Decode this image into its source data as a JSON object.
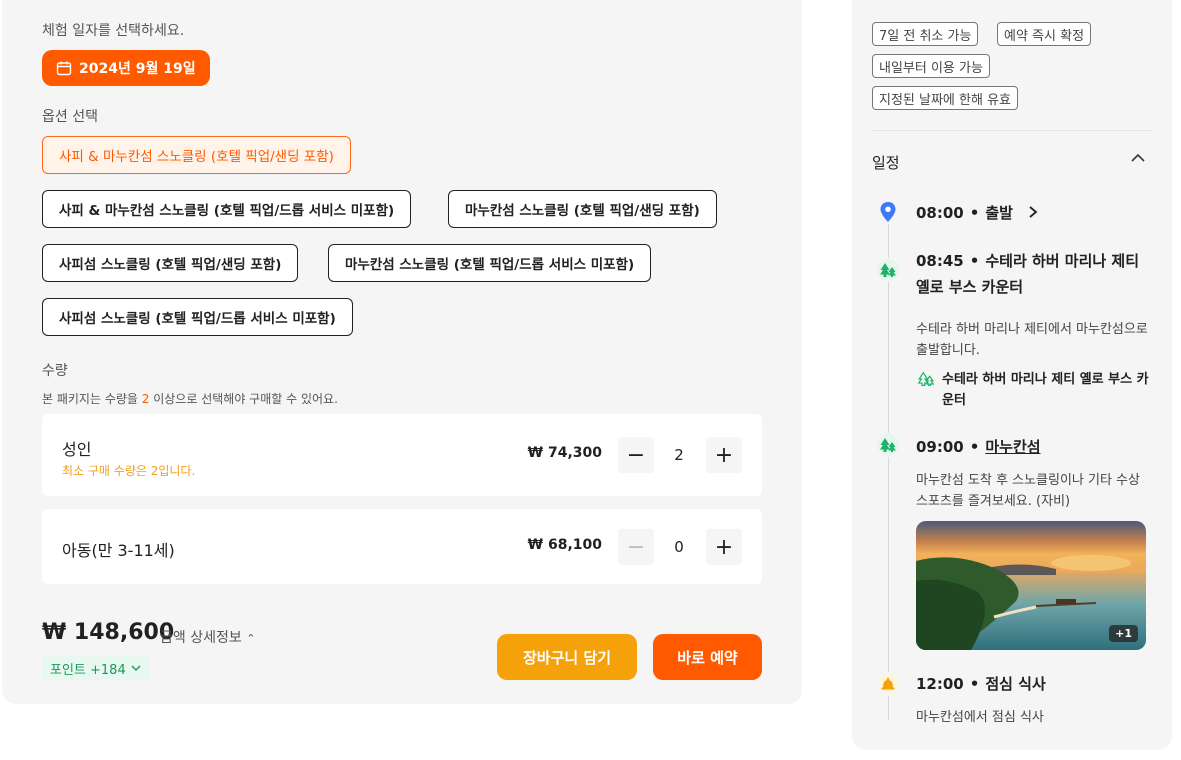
{
  "booking": {
    "date_label": "체험 일자를 선택하세요.",
    "selected_date": "2024년 9월 19일",
    "option_label": "옵션 선택",
    "options": [
      "사피 & 마누칸섬 스노클링 (호텔 픽업/샌딩 포함)",
      "사피 & 마누칸섬 스노클링 (호텔 픽업/드롭 서비스 미포함)",
      "마누칸섬 스노클링 (호텔 픽업/샌딩 포함)",
      "사피섬 스노클링 (호텔 픽업/샌딩 포함)",
      "마누칸섬 스노클링 (호텔 픽업/드롭 서비스 미포함)",
      "사피섬 스노클링 (호텔 픽업/드롭 서비스 미포함)"
    ],
    "selected_option_index": 0,
    "quantity_label": "수량",
    "quantity_note_before": "본 패키지는 수량을 ",
    "quantity_note_number": "2",
    "quantity_note_after": " 이상으로 선택해야 구매할 수 있어요.",
    "items": [
      {
        "name": "성인",
        "sub": "최소 구매 수량은 2입니다.",
        "price": "₩ 74,300",
        "qty": "2",
        "minus": "−",
        "plus": "+"
      },
      {
        "name": "아동(만 3-11세)",
        "sub": "",
        "price": "₩ 68,100",
        "qty": "0",
        "minus": "−",
        "plus": "+"
      }
    ],
    "total": "₩ 148,600",
    "detail_link": "금액 상세정보",
    "points": "포인트 +184",
    "cart_button": "장바구니 담기",
    "book_button": "바로 예약"
  },
  "itinerary": {
    "tags": [
      "7일 전 취소 가능",
      "예약 즉시 확정",
      "내일부터 이용 가능",
      "지정된 날짜에 한해 유효"
    ],
    "title": "일정",
    "steps": [
      {
        "time": "08:00",
        "title": "출발",
        "icon": "location-pin-icon"
      },
      {
        "time": "08:45",
        "title": "수테라 하버 마리나 제티 옐로 부스 카운터",
        "desc": "수테라 하버 마리나 제티에서 마누칸섬으로 출발합니다.",
        "place": "수테라 하버 마리나 제티 옐로 부스 카운터",
        "icon": "trees-icon"
      },
      {
        "time": "09:00",
        "title": "마누칸섬",
        "desc": "마누칸섬 도착 후 스노클링이나 기타 수상 스포츠를 즐겨보세요. (자비)",
        "photo_badge": "+1",
        "icon": "trees-icon"
      },
      {
        "time": "12:00",
        "title": "점심 식사",
        "desc": "마누칸섬에서 점심 식사",
        "icon": "bell-icon"
      }
    ],
    "separator": "•"
  },
  "colors": {
    "accent": "#ff5a00",
    "cart": "#f5a10a",
    "points": "#1a9b5a",
    "location_blue": "#3d7af5",
    "trees_green": "#1db36b",
    "bell_orange": "#f5a10a"
  }
}
